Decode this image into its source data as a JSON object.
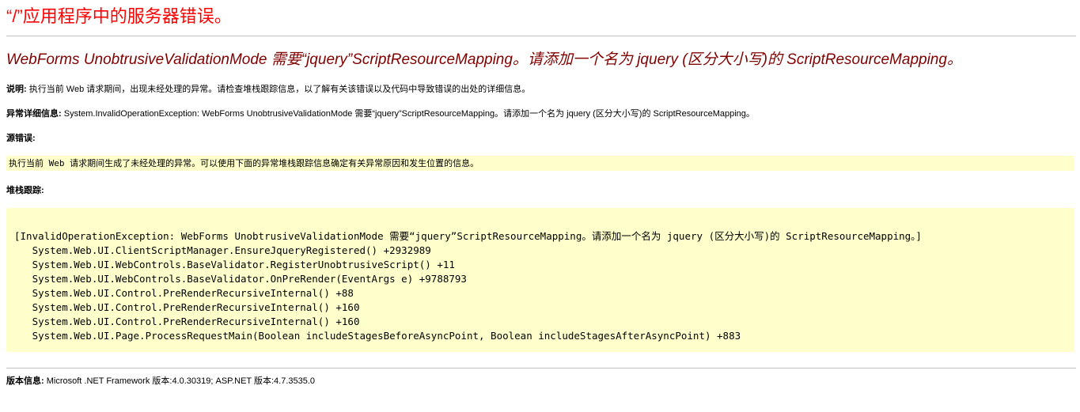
{
  "header": {
    "title": "“/”应用程序中的服务器错误。"
  },
  "error": {
    "message": "WebForms UnobtrusiveValidationMode 需要“jquery”ScriptResourceMapping。请添加一个名为 jquery (区分大小写)的 ScriptResourceMapping。"
  },
  "description": {
    "label": "说明:",
    "text": "执行当前 Web 请求期间，出现未经处理的异常。请检查堆栈跟踪信息，以了解有关该错误以及代码中导致错误的出处的详细信息。"
  },
  "exception_details": {
    "label": "异常详细信息:",
    "text": "System.InvalidOperationException: WebForms UnobtrusiveValidationMode 需要“jquery”ScriptResourceMapping。请添加一个名为 jquery (区分大小写)的 ScriptResourceMapping。"
  },
  "source_error": {
    "label": "源错误:",
    "text": "执行当前 Web 请求期间生成了未经处理的异常。可以使用下面的异常堆栈跟踪信息确定有关异常原因和发生位置的信息。"
  },
  "stack_trace": {
    "label": "堆栈跟踪:",
    "lines": [
      "[InvalidOperationException: WebForms UnobtrusiveValidationMode 需要“jquery”ScriptResourceMapping。请添加一个名为 jquery (区分大小写)的 ScriptResourceMapping。]",
      "   System.Web.UI.ClientScriptManager.EnsureJqueryRegistered() +2932989",
      "   System.Web.UI.WebControls.BaseValidator.RegisterUnobtrusiveScript() +11",
      "   System.Web.UI.WebControls.BaseValidator.OnPreRender(EventArgs e) +9788793",
      "   System.Web.UI.Control.PreRenderRecursiveInternal() +88",
      "   System.Web.UI.Control.PreRenderRecursiveInternal() +160",
      "   System.Web.UI.Control.PreRenderRecursiveInternal() +160",
      "   System.Web.UI.Page.ProcessRequestMain(Boolean includeStagesBeforeAsyncPoint, Boolean includeStagesAfterAsyncPoint) +883"
    ]
  },
  "version": {
    "label": "版本信息:",
    "text": "Microsoft .NET Framework 版本:4.0.30319; ASP.NET 版本:4.7.3535.0"
  },
  "colors": {
    "title": "#ff0000",
    "message": "#800000",
    "code_background": "#ffffcc",
    "rule": "#c0c0c0"
  }
}
